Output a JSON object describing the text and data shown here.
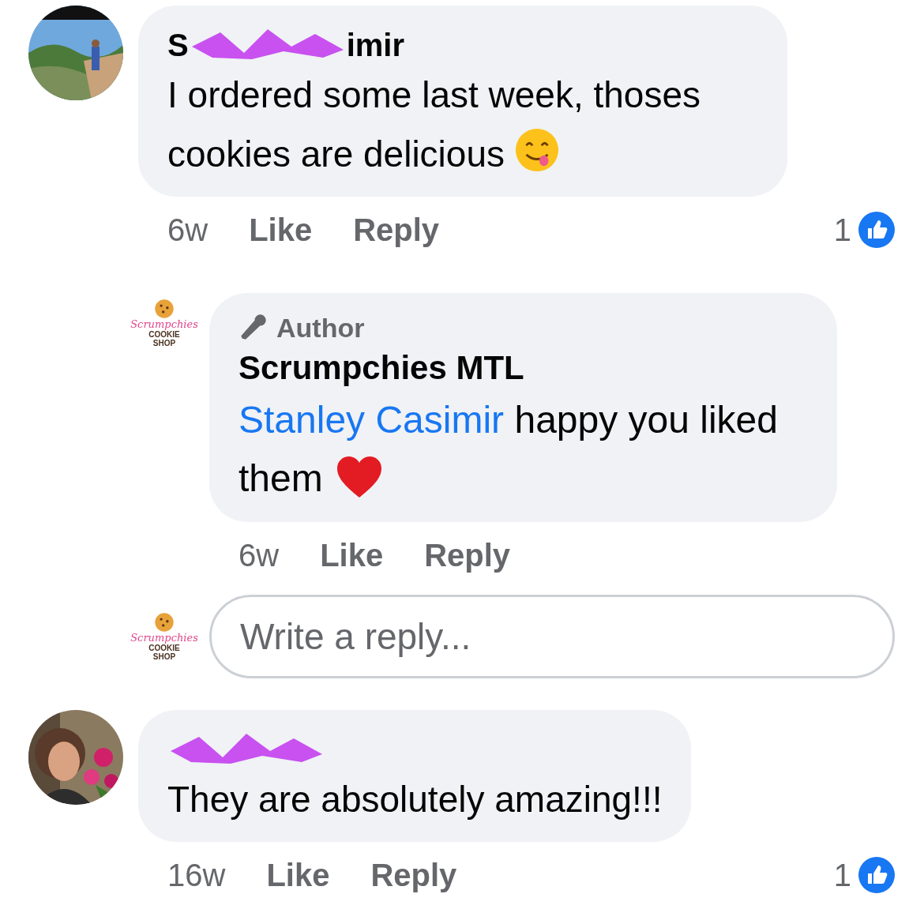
{
  "comments": [
    {
      "avatar": {
        "kind": "picture"
      },
      "redacted": true,
      "name_parts": [
        "S",
        "imir"
      ],
      "text": "I ordered some last week, thoses cookies are delicious",
      "emoji": {
        "kind": "yum"
      },
      "time": "6w",
      "actions": [
        "Like",
        "Reply"
      ],
      "reaction_count": "1",
      "replies": [
        {
          "avatar": {
            "kind": "logo",
            "logo_lines": [
              "Scrumpchies",
              "COOKIE",
              "SHOP"
            ]
          },
          "badge": "Author",
          "name": "Scrumpchies MTL",
          "mention": "Stanley Casimir",
          "text": "happy you liked them",
          "emoji": {
            "kind": "heart"
          },
          "time": "6w",
          "actions": [
            "Like",
            "Reply"
          ]
        }
      ],
      "reply_box": {
        "avatar": {
          "kind": "logo",
          "logo_lines": [
            "Scrumpchies",
            "COOKIE",
            "SHOP"
          ]
        },
        "placeholder": "Write a reply..."
      }
    },
    {
      "avatar": {
        "kind": "picture"
      },
      "redacted": true,
      "text": "They are absolutely amazing!!!",
      "time": "16w",
      "actions": [
        "Like",
        "Reply"
      ],
      "reaction_count": "1"
    }
  ]
}
